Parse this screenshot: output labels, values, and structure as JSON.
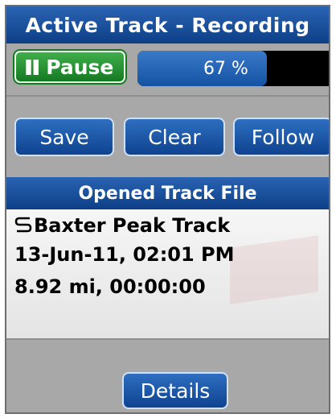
{
  "header": {
    "title": "Active Track - Recording"
  },
  "controls": {
    "pause_label": "Pause",
    "progress_text": "67 %",
    "progress_fraction": 0.67
  },
  "actions": {
    "save_label": "Save",
    "clear_label": "Clear",
    "follow_label": "Follow"
  },
  "opened_track": {
    "section_title": "Opened Track File",
    "name": "Baxter Peak Track",
    "date": "13-Jun-11, 02:01 PM",
    "stats": "8.92 mi, 00:00:00"
  },
  "footer": {
    "details_label": "Details"
  },
  "colors": {
    "header_blue": "#1c4f9c",
    "pause_green": "#1f8f2c",
    "progress_bg": "#000000",
    "panel_gray": "#a8a8a8"
  },
  "icons": {
    "pause": "pause-icon",
    "track": "track-icon"
  }
}
